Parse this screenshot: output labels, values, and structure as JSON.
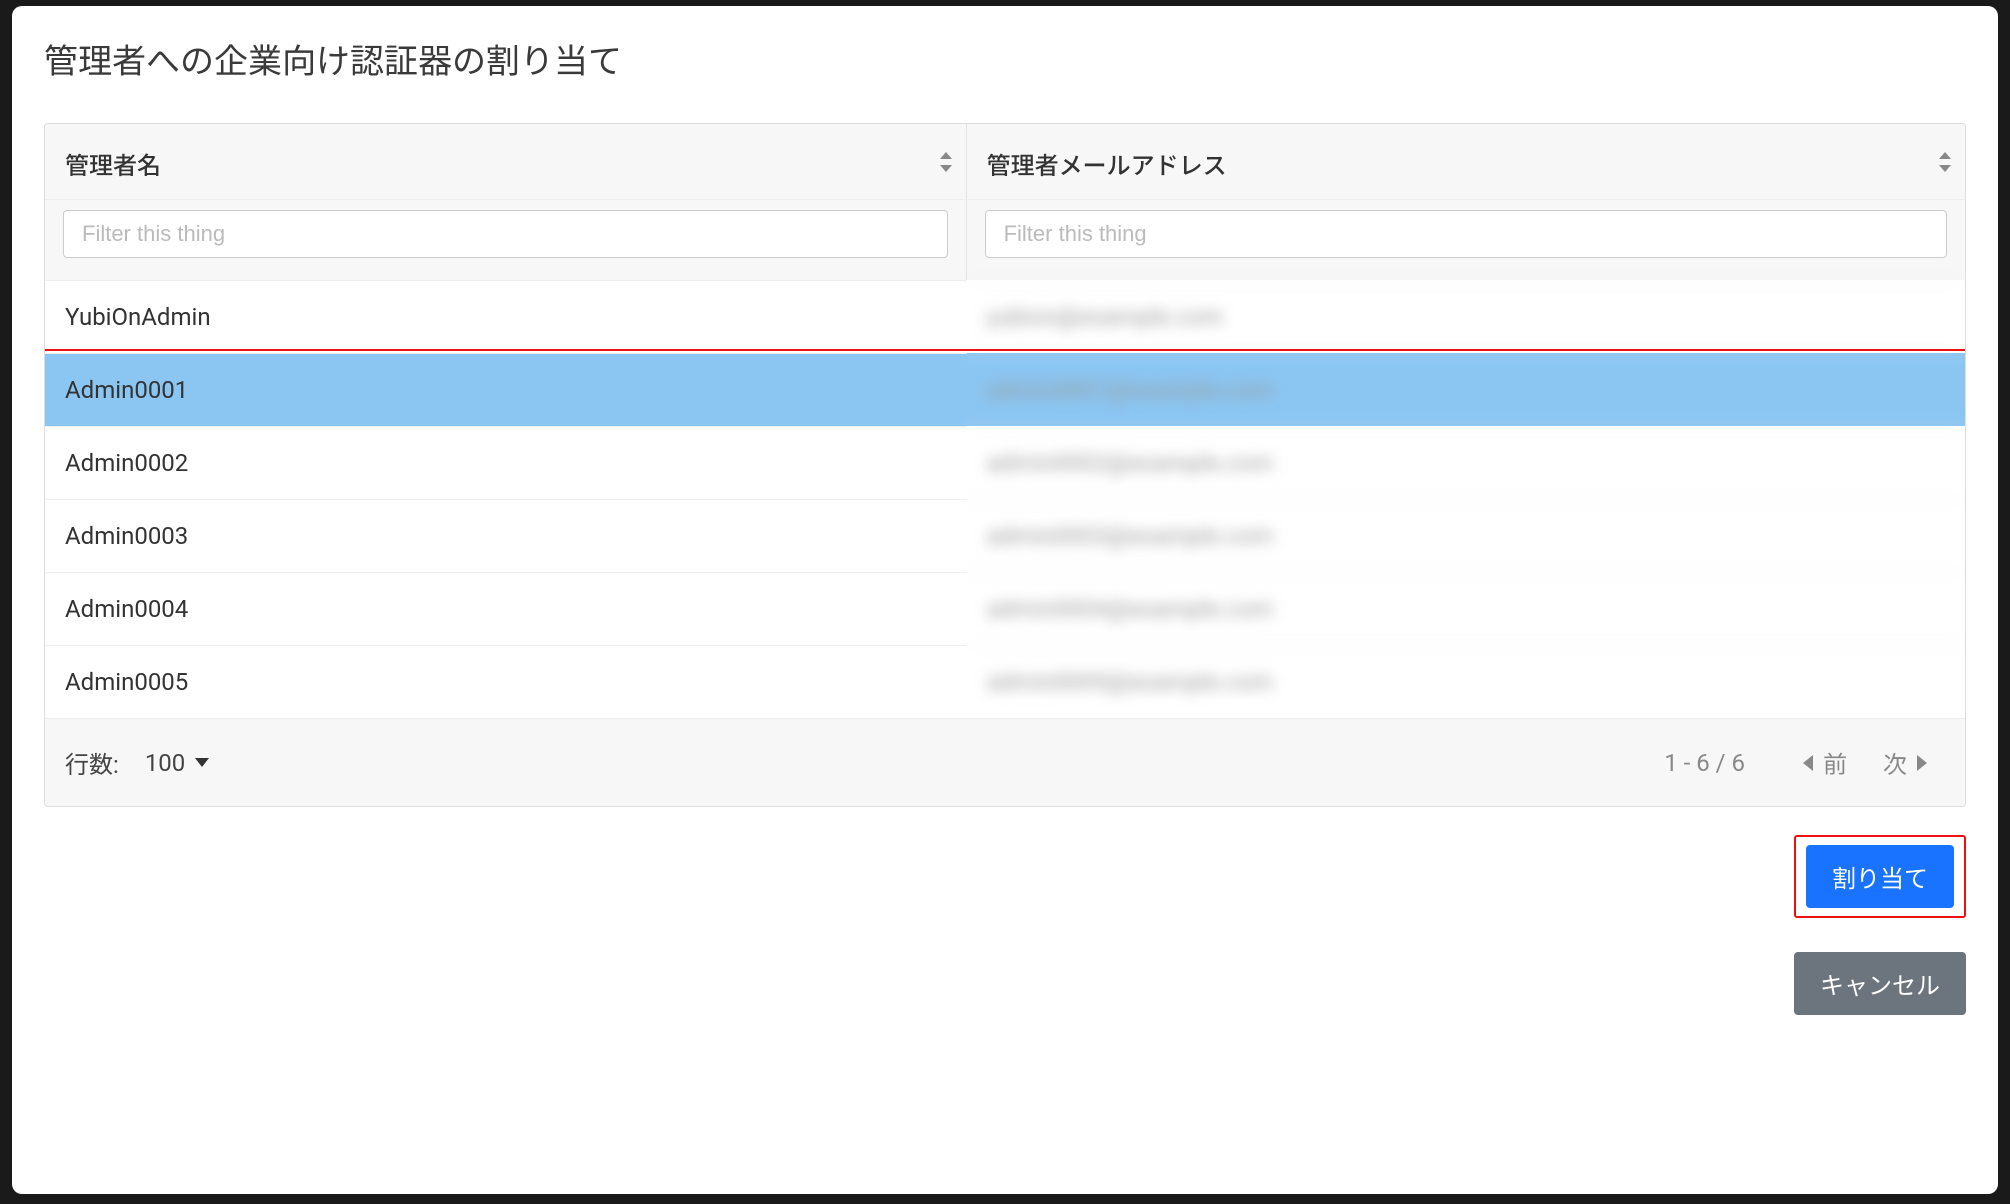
{
  "modal": {
    "title": "管理者への企業向け認証器の割り当て"
  },
  "table": {
    "columns": {
      "name": "管理者名",
      "email": "管理者メールアドレス"
    },
    "filter_placeholder": "Filter this thing",
    "rows": [
      {
        "name": "YubiOnAdmin",
        "email": "yubion@example.com",
        "selected": false
      },
      {
        "name": "Admin0001",
        "email": "admin0001@example.com",
        "selected": true
      },
      {
        "name": "Admin0002",
        "email": "admin0002@example.com",
        "selected": false
      },
      {
        "name": "Admin0003",
        "email": "admin0003@example.com",
        "selected": false
      },
      {
        "name": "Admin0004",
        "email": "admin0004@example.com",
        "selected": false
      },
      {
        "name": "Admin0005",
        "email": "admin0005@example.com",
        "selected": false
      }
    ]
  },
  "footer": {
    "rows_label": "行数:",
    "page_size": "100",
    "range": "1 - 6 / 6",
    "prev": "前",
    "next": "次"
  },
  "buttons": {
    "assign": "割り当て",
    "cancel": "キャンセル"
  }
}
